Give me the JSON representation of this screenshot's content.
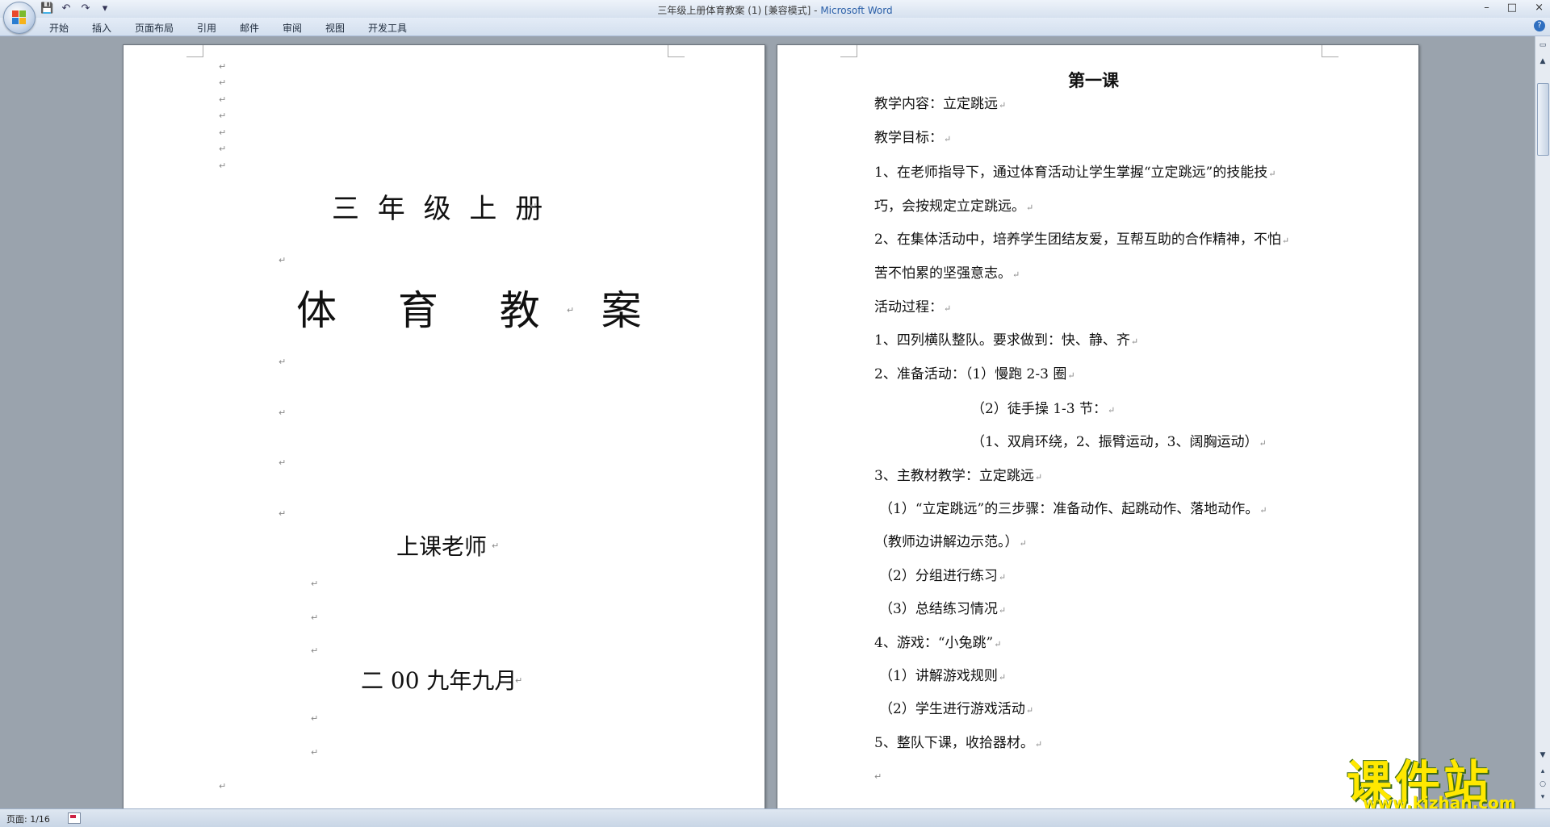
{
  "window": {
    "title_doc": "三年级上册体育教案 (1) [兼容模式] - ",
    "title_app": "Microsoft Word",
    "controls": [
      "–",
      "□",
      "×"
    ]
  },
  "qat": {
    "save": "💾",
    "undo": "↶",
    "redo": "↷",
    "customize": "▾"
  },
  "ribbon_tabs": [
    "开始",
    "插入",
    "页面布局",
    "引用",
    "邮件",
    "审阅",
    "视图",
    "开发工具"
  ],
  "page1": {
    "grade": "三 年 级 上 册",
    "title": "体 育 教 案",
    "teacher_label": "上课老师",
    "date": "二 00 九年九月"
  },
  "page2": {
    "heading": "第一课",
    "paragraphs": [
      "教学内容：立定跳远",
      "教学目标：",
      "1、在老师指导下，通过体育活动让学生掌握“立定跳远”的技能技",
      "巧，会按规定立定跳远。",
      "2、在集体活动中，培养学生团结友爱，互帮互助的合作精神，不怕",
      "苦不怕累的坚强意志。",
      "活动过程：",
      "1、四列横队整队。要求做到：快、静、齐",
      "2、准备活动：（1）慢跑 2-3 圈",
      "（2）徒手操 1-3 节：",
      "（1、双肩环绕，2、振臂运动，3、阔胸运动）",
      "3、主教材教学：立定跳远",
      "（1）“立定跳远”的三步骤：准备动作、起跳动作、落地动作。",
      "（教师边讲解边示范。）",
      "（2）分组进行练习",
      "（3）总结练习情况",
      "4、游戏：“小兔跳”",
      "（1）讲解游戏规则",
      "（2）学生进行游戏活动",
      "5、整队下课，收拾器材。"
    ]
  },
  "paragraph_mark": "↵",
  "statusbar": {
    "page": "页面: 1/16"
  },
  "watermark": {
    "brand": "课件站",
    "url": "www.kjzhan.com"
  },
  "colors": {
    "app_title": "#2a5fa8",
    "watermark": "#ffe800"
  }
}
